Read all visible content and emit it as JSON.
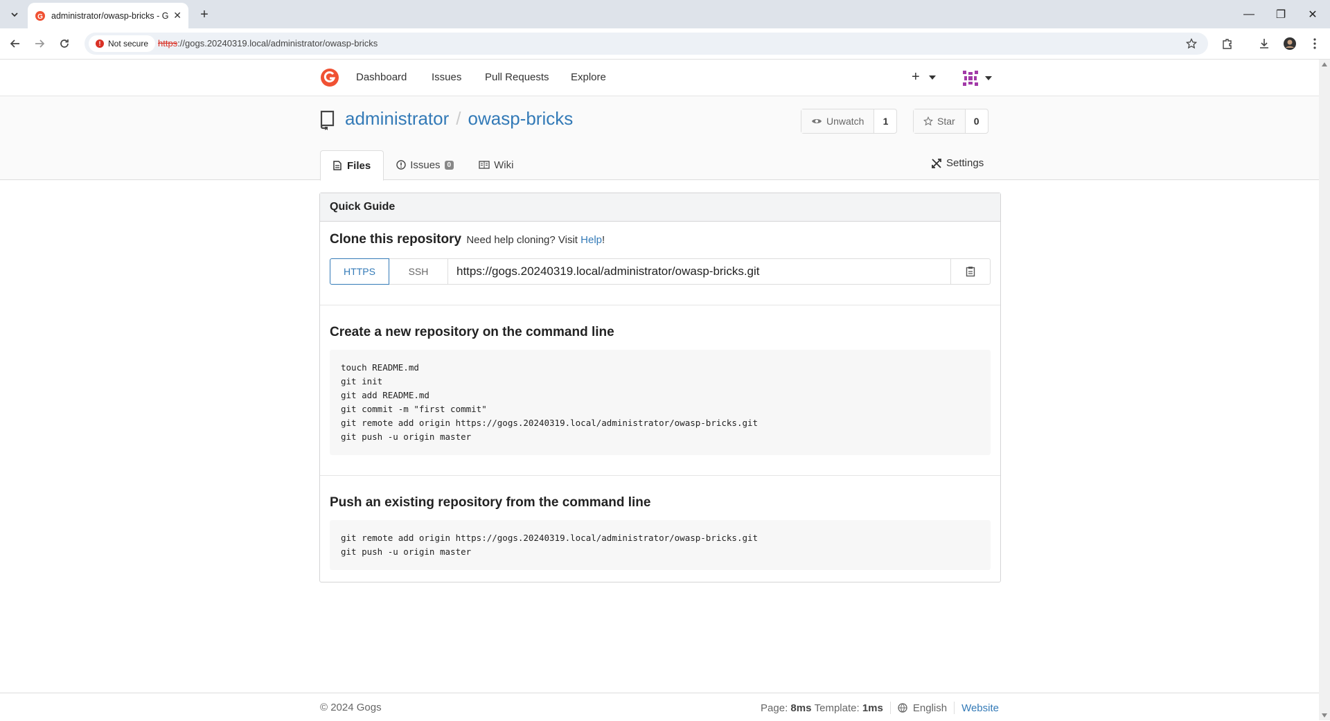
{
  "browser": {
    "tab_title": "administrator/owasp-bricks - Gogs",
    "security_label": "Not secure",
    "url_scheme": "https",
    "url_rest": "://gogs.20240319.local/administrator/owasp-bricks"
  },
  "nav": {
    "items": [
      "Dashboard",
      "Issues",
      "Pull Requests",
      "Explore"
    ],
    "plus": "+"
  },
  "repo": {
    "owner": "administrator",
    "separator": "/",
    "name": "owasp-bricks",
    "unwatch_label": "Unwatch",
    "watch_count": "1",
    "star_label": "Star",
    "star_count": "0",
    "tabs": {
      "files": "Files",
      "issues": "Issues",
      "issues_count": "0",
      "wiki": "Wiki"
    },
    "settings": "Settings"
  },
  "guide": {
    "header": "Quick Guide",
    "clone_title": "Clone this repository",
    "help_prefix": "Need help cloning? Visit",
    "help_link": "Help",
    "help_suffix": "!",
    "https_label": "HTTPS",
    "ssh_label": "SSH",
    "clone_url": "https://gogs.20240319.local/administrator/owasp-bricks.git",
    "new_repo_title": "Create a new repository on the command line",
    "new_repo_lines": [
      "touch README.md",
      "git init",
      "git add README.md",
      "git commit -m \"first commit\"",
      "git remote add origin https://gogs.20240319.local/administrator/owasp-bricks.git",
      "git push -u origin master"
    ],
    "push_title": "Push an existing repository from the command line",
    "push_lines": [
      "git remote add origin https://gogs.20240319.local/administrator/owasp-bricks.git",
      "git push -u origin master"
    ]
  },
  "footer": {
    "copyright": "© 2024 Gogs",
    "page_label": "Page:",
    "page_time": "8ms",
    "template_label": "Template:",
    "template_time": "1ms",
    "language": "English",
    "website": "Website"
  },
  "colors": {
    "link": "#337ab7",
    "brand": "#f05133",
    "insecure": "#d93025"
  }
}
